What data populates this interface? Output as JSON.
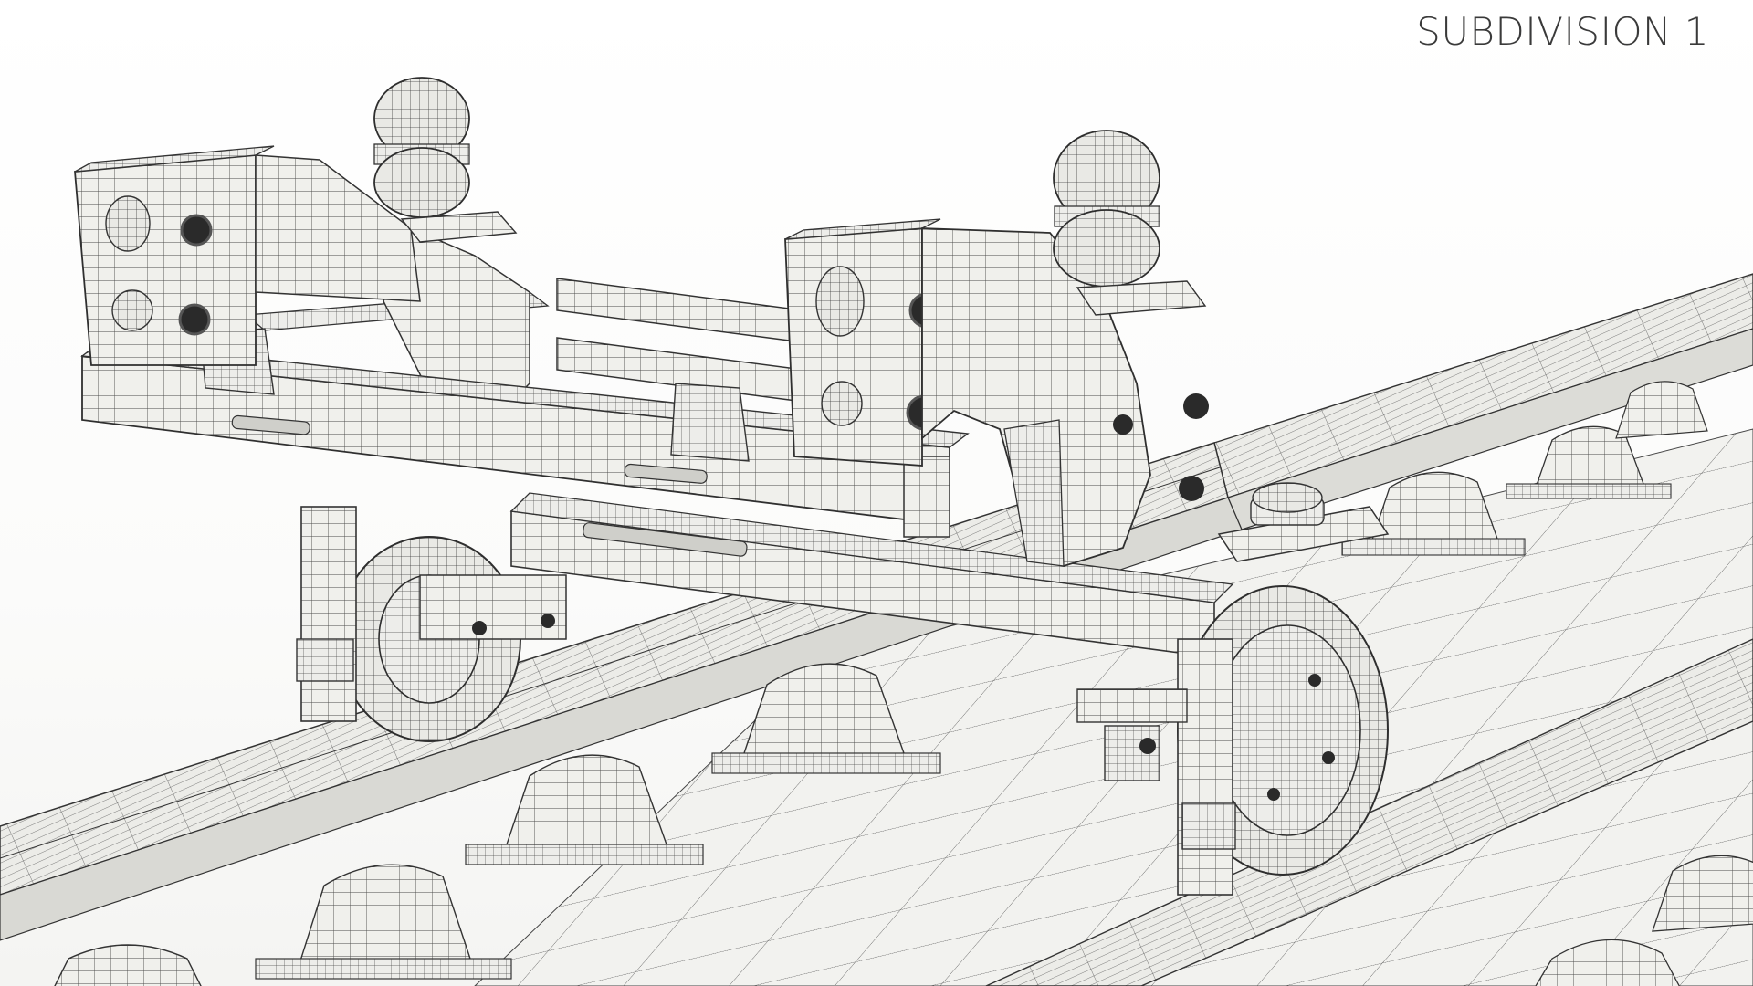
{
  "viewport": {
    "caption": "SUBDIVISION 1"
  },
  "colors": {
    "background": "#ffffff",
    "surface": "#efefeb",
    "surface_dark": "#d8d8d3",
    "wire": "#3c3c3c",
    "caption": "#3a3a3a"
  },
  "icons": [
    "wireframe-rail-trolley-model"
  ]
}
